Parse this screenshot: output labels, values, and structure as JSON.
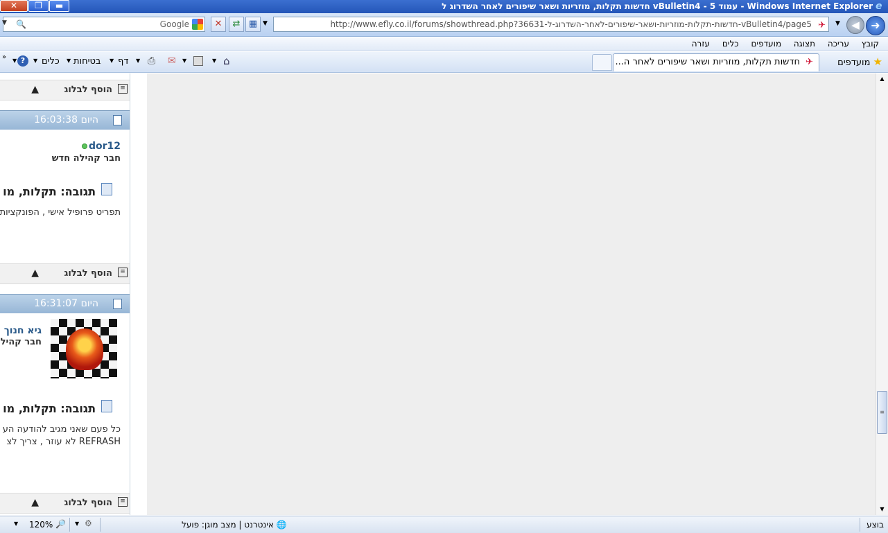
{
  "window": {
    "title": "Windows Internet Explorer - עמוד 5 - vBulletin4 חדשות תקלות, מוזריות ושאר שיפורים לאחר השדרוג ל",
    "close_glyph": "✕",
    "max_glyph": "❐",
    "min_glyph": "▬"
  },
  "address_bar": {
    "url": "http://www.efly.co.il/forums/showthread.php?36631-חדשות-תקלות-מוזריות-ושאר-שיפורים-לאחר-השדרוג-ל-vBulletin4/page5",
    "search_placeholder": "Google"
  },
  "menu": [
    "קובץ",
    "עריכה",
    "תצוגה",
    "מועדפים",
    "כלים",
    "עזרה"
  ],
  "commandbar": {
    "favorites_label": "מועדפים",
    "tab_title": "חדשות תקלות, מוזריות ושאר שיפורים לאחר ה...",
    "page_label": "דף",
    "safety_label": "בטיחות",
    "tools_label": "כלים",
    "more_glyph": "»"
  },
  "posts": [
    {
      "footer_blog": "הוסף לבלוג"
    },
    {
      "date": "היום",
      "time": "16:03:38",
      "username": "dor12",
      "usertitle": "חבר קהילה חדש",
      "title": "תגובה: תקלות, מו",
      "text_lines": [
        "תפריט פרופיל אישי , הפונקציות"
      ],
      "footer_blog": "הוסף לבלוג"
    },
    {
      "date": "היום",
      "time": "16:31:07",
      "username": "גיא חנוך",
      "usertitle": "חבר קהיל",
      "title": "תגובה: תקלות, מו",
      "text_lines": [
        "כל פעם שאני מגיב להודעה הע",
        "REFRASH לא עוזר , צריך לצ"
      ],
      "footer_blog": "הוסף לבלוג"
    }
  ],
  "statusbar": {
    "done": "בוצע",
    "zone": "אינטרנט | מצב מוגן: פועל",
    "zoom": "120%"
  }
}
